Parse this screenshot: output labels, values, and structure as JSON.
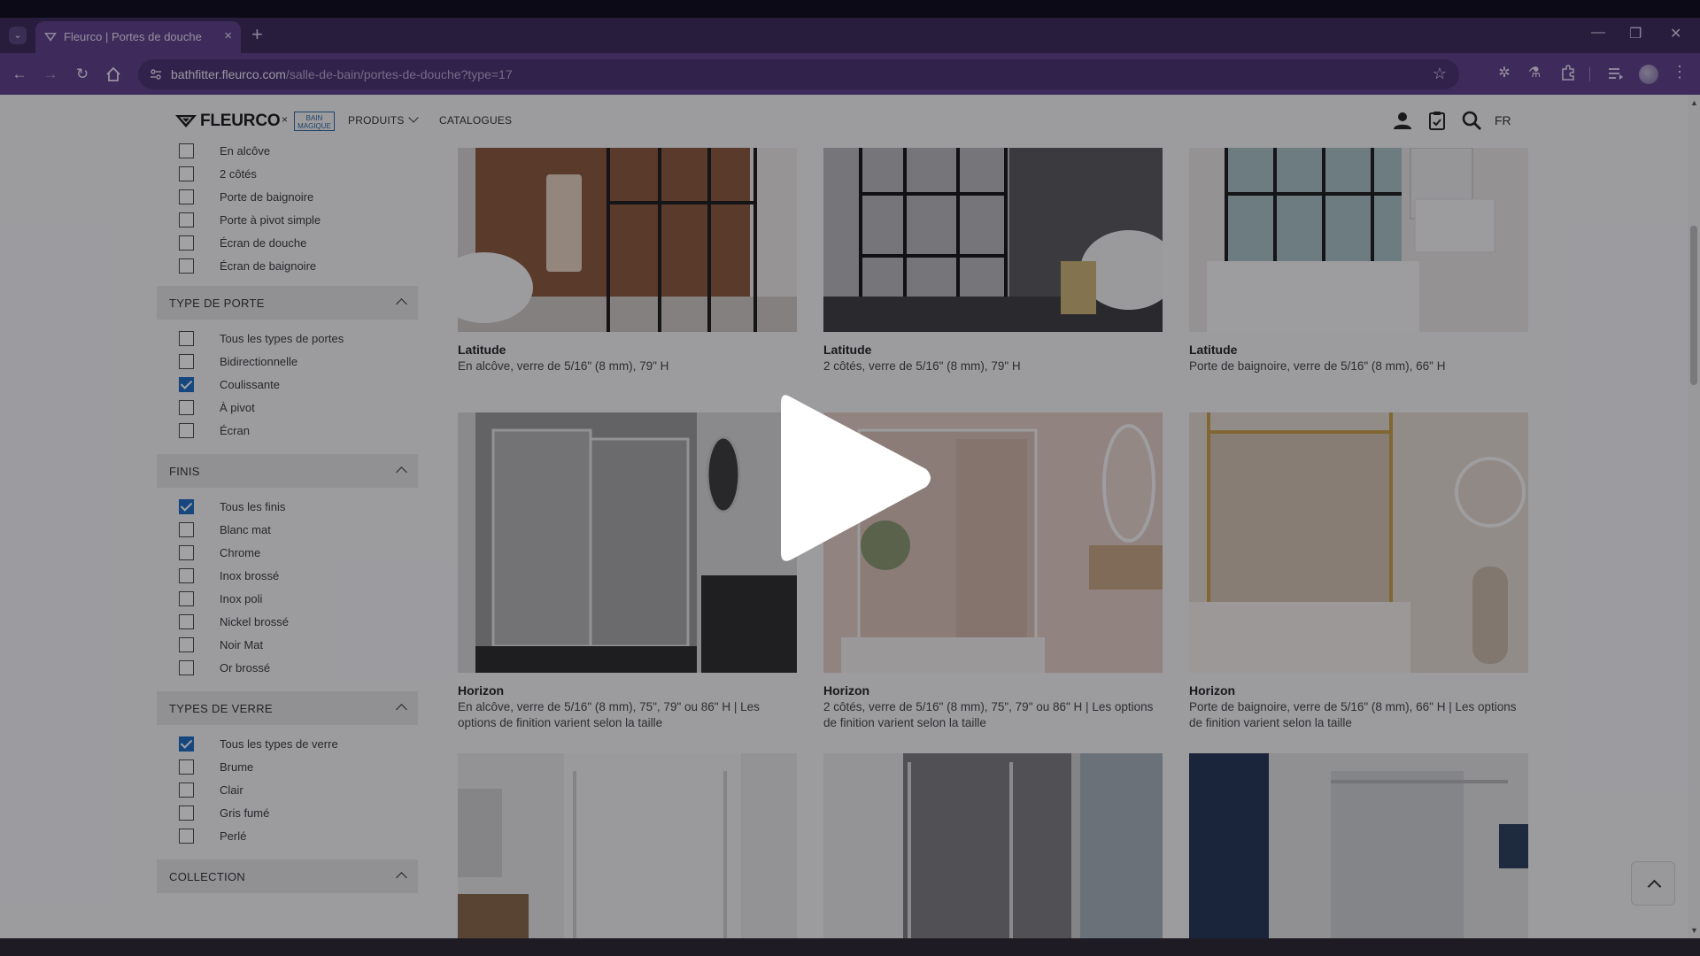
{
  "browser": {
    "tab_title": "Fleurco | Portes de douche",
    "url_host": "bathfitter.fleurco.com",
    "url_path": "/salle-de-bain/portes-de-douche?type=17"
  },
  "header": {
    "logo_text": "FLEURCO",
    "logo_x": "×",
    "logo_partner": "BAIN MAGIQUE",
    "nav": [
      {
        "label": "PRODUITS"
      },
      {
        "label": "CATALOGUES"
      }
    ],
    "lang": "FR"
  },
  "sidebar": {
    "installation_items": [
      {
        "label": "En alcôve",
        "checked": false
      },
      {
        "label": "2 côtés",
        "checked": false
      },
      {
        "label": "Porte de baignoire",
        "checked": false
      },
      {
        "label": "Porte à pivot simple",
        "checked": false
      },
      {
        "label": "Écran de douche",
        "checked": false
      },
      {
        "label": "Écran de baignoire",
        "checked": false
      }
    ],
    "sections": [
      {
        "title": "TYPE DE PORTE",
        "items": [
          {
            "label": "Tous les types de portes",
            "checked": false
          },
          {
            "label": "Bidirectionnelle",
            "checked": false
          },
          {
            "label": "Coulissante",
            "checked": true
          },
          {
            "label": "À pivot",
            "checked": false
          },
          {
            "label": "Écran",
            "checked": false
          }
        ]
      },
      {
        "title": "FINIS",
        "items": [
          {
            "label": "Tous les finis",
            "checked": true
          },
          {
            "label": "Blanc mat",
            "checked": false
          },
          {
            "label": "Chrome",
            "checked": false
          },
          {
            "label": "Inox brossé",
            "checked": false
          },
          {
            "label": "Inox poli",
            "checked": false
          },
          {
            "label": "Nickel brossé",
            "checked": false
          },
          {
            "label": "Noir Mat",
            "checked": false
          },
          {
            "label": "Or brossé",
            "checked": false
          }
        ]
      },
      {
        "title": "TYPES DE VERRE",
        "items": [
          {
            "label": "Tous les types de verre",
            "checked": true
          },
          {
            "label": "Brume",
            "checked": false
          },
          {
            "label": "Clair",
            "checked": false
          },
          {
            "label": "Gris fumé",
            "checked": false
          },
          {
            "label": "Perlé",
            "checked": false
          }
        ]
      },
      {
        "title": "COLLECTION",
        "items": []
      }
    ]
  },
  "products": [
    {
      "name": "Latitude",
      "description": "En alcôve, verre de 5/16\" (8 mm), 79\" H",
      "style": "latitude-alcove"
    },
    {
      "name": "Latitude",
      "description": "2 côtés, verre de 5/16\" (8 mm), 79\" H",
      "style": "latitude-corner"
    },
    {
      "name": "Latitude",
      "description": "Porte de baignoire, verre de 5/16\" (8 mm), 66\" H",
      "style": "latitude-tub"
    },
    {
      "name": "Horizon",
      "description": "En alcôve, verre de 5/16\" (8 mm), 75\", 79\" ou 86\" H | Les options de finition varient selon la taille",
      "style": "horizon-alcove"
    },
    {
      "name": "Horizon",
      "description": "2 côtés, verre de 5/16\" (8 mm), 75\", 79\" ou 86\" H | Les options de finition varient selon la taille",
      "style": "horizon-corner"
    },
    {
      "name": "Horizon",
      "description": "Porte de baignoire, verre de 5/16\" (8 mm), 66\" H | Les options de finition varient selon la taille",
      "style": "horizon-tub"
    },
    {
      "name": "",
      "description": "",
      "style": "row3-a"
    },
    {
      "name": "",
      "description": "",
      "style": "row3-b"
    },
    {
      "name": "",
      "description": "",
      "style": "row3-c"
    }
  ],
  "colors": {
    "accent_check": "#1c6ec2",
    "browser_theme": "#5e3f8a"
  }
}
